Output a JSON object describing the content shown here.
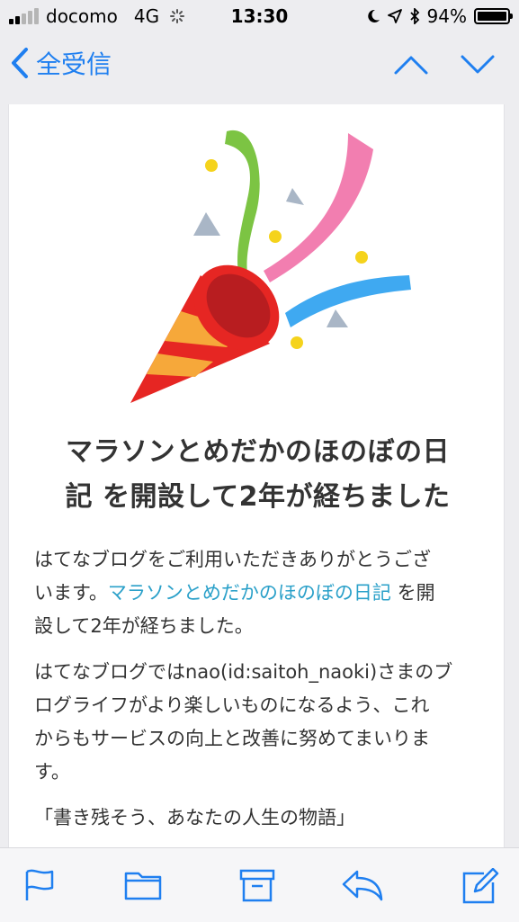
{
  "status_bar": {
    "carrier": "docomo",
    "network": "4G",
    "time": "13:30",
    "battery": "94%"
  },
  "nav": {
    "back_label": "全受信"
  },
  "email": {
    "title_line1": "マラソンとめだかのほのぼの日",
    "title_line2": "記 を開設して2年が経ちました",
    "p1_line1": "はてなブログをご利用いただきありがとうござ",
    "p1_line2a": "います。",
    "p1_link": "マラソンとめだかのほのぼの日記",
    "p1_line2b": " を開",
    "p1_line3": "設して2年が経ちました。",
    "p2_line1": "はてなブログではnao(id:saitoh_naoki)さまのブ",
    "p2_line2": "ログライフがより楽しいものになるよう、これ",
    "p2_line3": "からもサービスの向上と改善に努めてまいりま",
    "p2_line4": "す。",
    "p3_line1": "「書き残そう、あなたの人生の物語」"
  },
  "colors": {
    "accent": "#1f7ff0",
    "link": "#2aa0c9"
  },
  "icons": [
    "flag-icon",
    "folder-icon",
    "archive-icon",
    "reply-icon",
    "compose-icon"
  ]
}
